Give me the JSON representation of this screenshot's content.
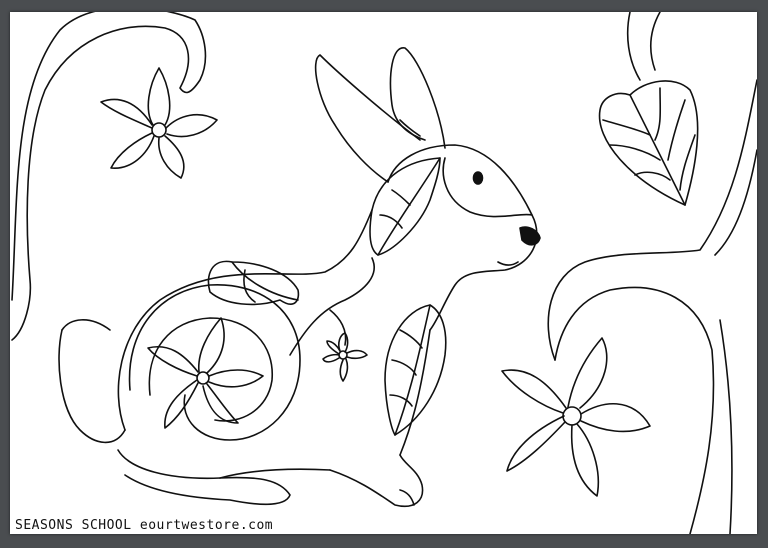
{
  "image": {
    "subject": "rabbit with leaves and flowers coloring page",
    "stroke_color": "#111111",
    "paper_color": "#ffffff",
    "border_color": "#4a4d50"
  },
  "caption": {
    "text": "SEASONS SCHOOL   eourtwestore.com"
  }
}
